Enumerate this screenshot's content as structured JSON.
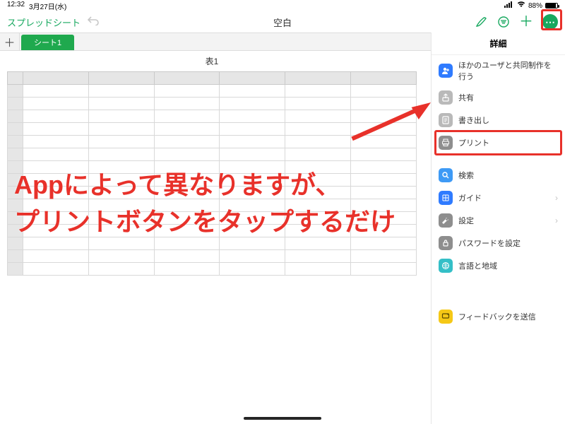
{
  "status": {
    "time": "12:32",
    "date": "3月27日(水)",
    "battery_pct": "88%"
  },
  "nav": {
    "back_label": "スプレッドシート",
    "doc_title": "空白"
  },
  "tabs": {
    "sheet1_label": "シート1"
  },
  "sheet": {
    "table_title": "表1"
  },
  "panel": {
    "title": "詳細",
    "items": {
      "collab": {
        "label": "ほかのユーザと共同制作を行う",
        "icon_bg": "#2f7bff"
      },
      "share": {
        "label": "共有",
        "icon_bg": "#b9b9b9"
      },
      "export": {
        "label": "書き出し",
        "icon_bg": "#b9b9b9"
      },
      "print": {
        "label": "プリント",
        "icon_bg": "#8e8e8e"
      },
      "search": {
        "label": "検索",
        "icon_bg": "#3e9af5"
      },
      "guide": {
        "label": "ガイド",
        "icon_bg": "#2f7bff"
      },
      "settings": {
        "label": "設定",
        "icon_bg": "#8e8e8e"
      },
      "password": {
        "label": "パスワードを設定",
        "icon_bg": "#8e8e8e"
      },
      "language": {
        "label": "言語と地域",
        "icon_bg": "#34bfc7"
      },
      "feedback": {
        "label": "フィードバックを送信",
        "icon_bg": "#f5c816"
      }
    }
  },
  "annotation": {
    "line1": "Appによって異なりますが、",
    "line2": "プリントボタンをタップするだけ"
  },
  "colors": {
    "accent_green": "#17a85f",
    "highlight_red": "#e8312a"
  }
}
